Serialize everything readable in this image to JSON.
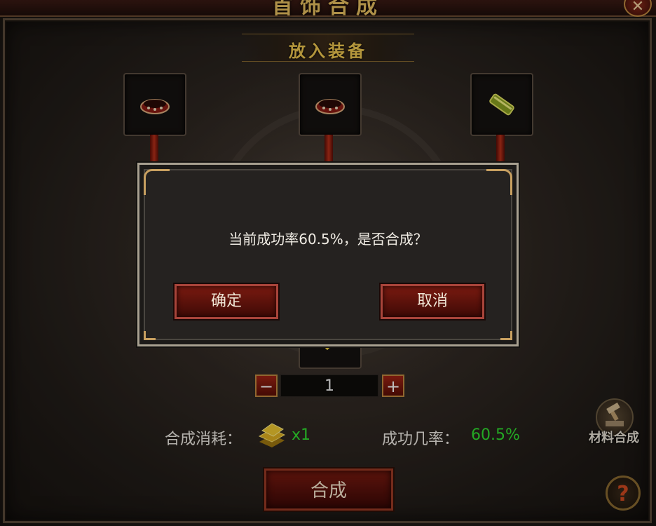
{
  "window": {
    "title": "首饰合成",
    "close_symbol": "✕"
  },
  "place_banner": "放入装备",
  "slots": [
    {
      "item": "ring-icon"
    },
    {
      "item": "ring-icon"
    },
    {
      "item": "gem-scroll-icon"
    }
  ],
  "quantity": {
    "value": "1",
    "minus_symbol": "−",
    "plus_symbol": "+"
  },
  "cost": {
    "label": "合成消耗：",
    "icon": "gold-bar-icon",
    "value": "x1"
  },
  "success": {
    "label": "成功几率：",
    "value": "60.5%"
  },
  "synthesize_button": "合成",
  "material_button": {
    "label": "材料合成",
    "icon": "hammer-anvil-icon"
  },
  "help_button": "?",
  "dialog": {
    "message": "当前成功率60.5%，是否合成？",
    "confirm_label": "确定",
    "cancel_label": "取消"
  },
  "colors": {
    "accent_gold": "#f0c850",
    "value_green": "#30e030",
    "button_red": "#7a1a10"
  }
}
